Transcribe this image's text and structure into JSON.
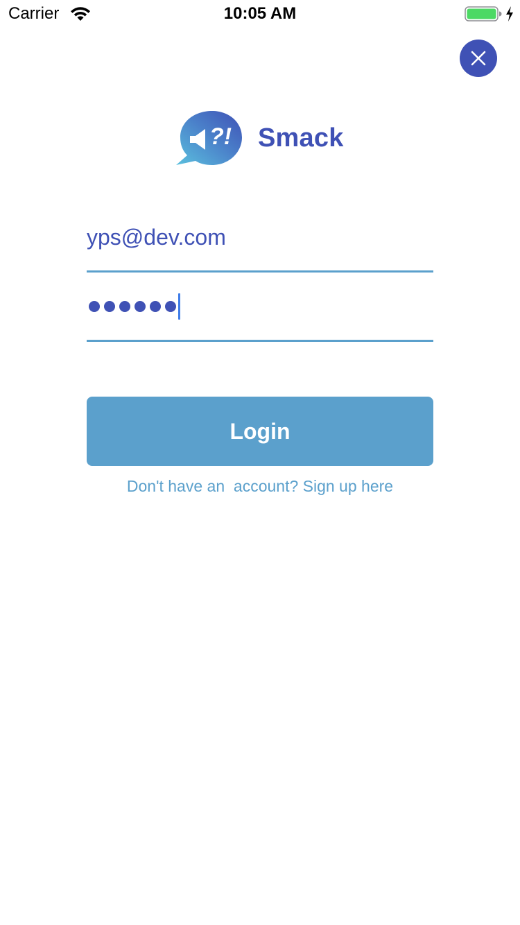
{
  "status_bar": {
    "carrier": "Carrier",
    "time": "10:05 AM",
    "icons": [
      "wifi-icon",
      "battery-icon",
      "charging-icon"
    ],
    "battery_color": "#4cd964"
  },
  "header": {
    "close_icon": "close-icon",
    "close_button_color": "#3f51b5"
  },
  "logo": {
    "icon": "speech-bubble-megaphone-icon",
    "icon_text": "?!",
    "name": "Smack",
    "brand_color": "#3f51b5"
  },
  "form": {
    "email": {
      "value": "yps@dev.com"
    },
    "password": {
      "masked_length": 6,
      "mask_char": "•"
    },
    "underline_color": "#5ba0cc"
  },
  "login_button": {
    "label": "Login",
    "color": "#5ba0cc"
  },
  "signup_link": {
    "text": "Don't have an  account? Sign up here"
  }
}
